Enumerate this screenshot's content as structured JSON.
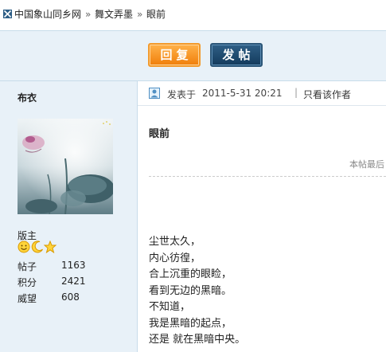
{
  "breadcrumb": {
    "items": [
      "中国象山同乡网",
      "舞文弄墨",
      "眼前"
    ],
    "separator": "»"
  },
  "toolbar": {
    "reply_label": "回复",
    "post_label": "发帖"
  },
  "user": {
    "name": "布衣",
    "rank": "版主",
    "badges": [
      "smile-icon",
      "moon-icon",
      "star-icon"
    ],
    "stats": [
      {
        "key": "帖子",
        "value": "1163"
      },
      {
        "key": "积分",
        "value": "2421"
      },
      {
        "key": "威望",
        "value": "608"
      }
    ]
  },
  "post": {
    "posted_label": "发表于",
    "posted_time": "2011-5-31 20:21",
    "separator": "|",
    "author_only": "只看该作者",
    "title": "眼前",
    "last_edit": "本帖最后",
    "content_lines": [
      "尘世太久，",
      "内心彷徨，",
      "合上沉重的眼睑，",
      "看到无边的黑暗。",
      "不知道，",
      "我是黑暗的起点，",
      "还是 就在黑暗中央。"
    ]
  },
  "colors": {
    "reply_button": "#f07e0a",
    "post_button": "#1a4266",
    "sidebar_bg": "#e8f1f8",
    "border": "#c8dcea"
  }
}
